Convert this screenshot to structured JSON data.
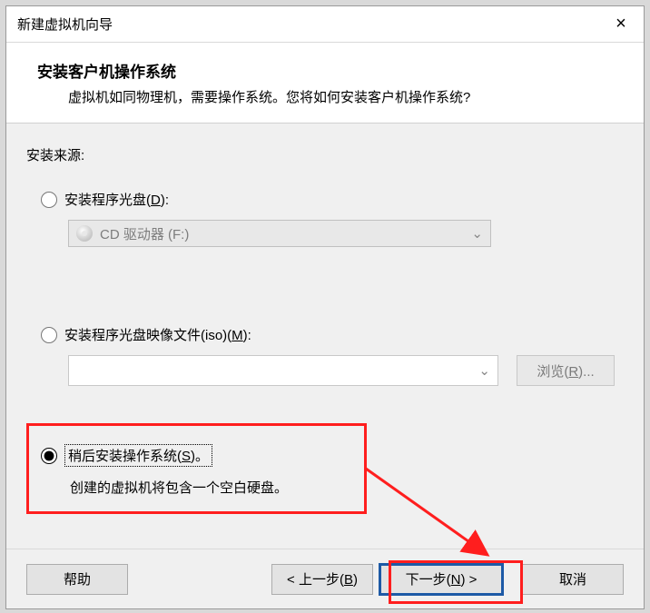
{
  "titlebar": {
    "title": "新建虚拟机向导",
    "close": "×"
  },
  "header": {
    "title": "安装客户机操作系统",
    "subtitle": "虚拟机如同物理机，需要操作系统。您将如何安装客户机操作系统?"
  },
  "body": {
    "source_label": "安装来源:",
    "opt_disc": {
      "pre": "安装程序光盘(",
      "hot": "D",
      "post": "):"
    },
    "drive_value": "CD 驱动器 (F:)",
    "opt_iso": {
      "pre": "安装程序光盘映像文件(iso)(",
      "hot": "M",
      "post": "):"
    },
    "browse": {
      "pre": "浏览(",
      "hot": "R",
      "post": ")..."
    },
    "opt_later": {
      "pre": "稍后安装操作系统(",
      "hot": "S",
      "post": ")。"
    },
    "later_hint": "创建的虚拟机将包含一个空白硬盘。"
  },
  "footer": {
    "help": "帮助",
    "back": {
      "pre": "< 上一步(",
      "hot": "B",
      "post": ")"
    },
    "next": {
      "pre": "下一步(",
      "hot": "N",
      "post": ") >"
    },
    "cancel": "取消"
  },
  "colors": {
    "accent": "#1d5aa6",
    "highlight": "#ff1e1e"
  }
}
